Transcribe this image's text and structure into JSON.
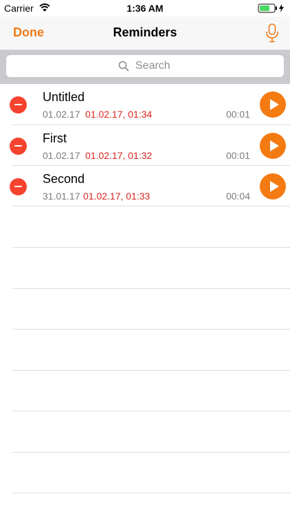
{
  "status_bar": {
    "carrier": "Carrier",
    "time": "1:36 AM",
    "battery_color": "#4cd964",
    "wifi_icon": "wifi-icon",
    "battery_icon": "battery-icon",
    "charging_icon": "charging-bolt-icon"
  },
  "nav": {
    "done_label": "Done",
    "title": "Reminders",
    "mic_icon": "microphone-icon"
  },
  "search": {
    "placeholder": "Search",
    "icon": "magnifier-icon"
  },
  "colors": {
    "accent": "#f07a18",
    "delete": "#f5432f",
    "alarm_text": "#d8251f",
    "play": "#f47a12"
  },
  "reminders": [
    {
      "name": "Untitled",
      "created": "01.02.17",
      "alarm": "01.02.17, 01:34",
      "duration": "00:01"
    },
    {
      "name": "First",
      "created": "01.02.17",
      "alarm": "01.02.17, 01:32",
      "duration": "00:01"
    },
    {
      "name": "Second",
      "created": "31.01.17",
      "alarm": "01.02.17, 01:33",
      "duration": "00:04"
    }
  ]
}
